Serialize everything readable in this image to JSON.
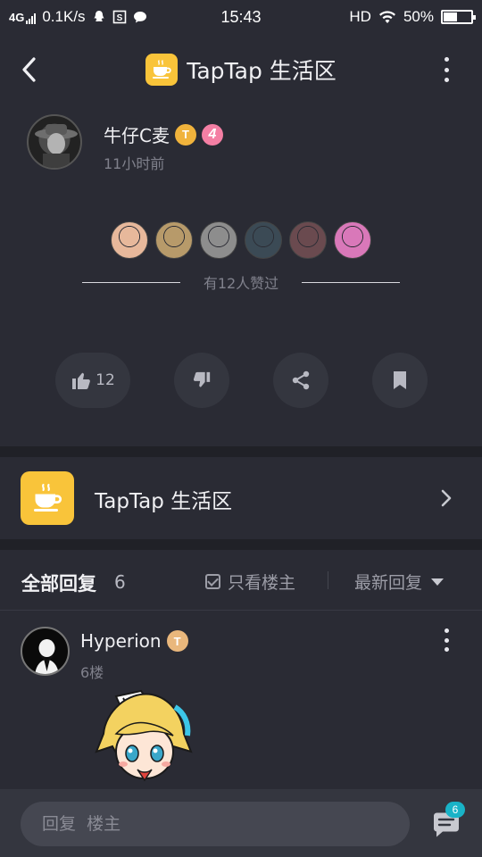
{
  "status_bar": {
    "network": "4G",
    "speed": "0.1K/s",
    "time": "15:43",
    "hd": "HD",
    "battery_percent": "50%",
    "battery_level": 0.5,
    "icons": [
      "qq-icon",
      "s-icon",
      "message-bubble-icon",
      "wifi-icon",
      "battery-icon"
    ]
  },
  "header": {
    "title": "TapTap 生活区",
    "back_icon": "back-arrow-icon",
    "more_icon": "more-vertical-icon"
  },
  "author": {
    "name": "牛仔C麦",
    "badge_t": "T",
    "level": "4",
    "time": "11小时前"
  },
  "likers": {
    "count_text": "有12人赞过",
    "avatar_colors": [
      "#e7b89b",
      "#b79a6a",
      "#8d8d8d",
      "#3b4a55",
      "#6a4a4f",
      "#d978b9"
    ]
  },
  "actions": {
    "like_count": "12",
    "icons": [
      "thumbs-up-icon",
      "thumbs-down-icon",
      "share-icon",
      "bookmark-icon"
    ]
  },
  "group": {
    "name": "TapTap 生活区",
    "icon": "coffee-cup-icon"
  },
  "replies": {
    "title": "全部回复",
    "count": "6",
    "only_op": "只看楼主",
    "sort": "最新回复"
  },
  "reply": {
    "name": "Hyperion",
    "badge_t": "T",
    "floor": "6楼"
  },
  "bottom": {
    "placeholder": "回复  楼主",
    "comment_count": "6"
  },
  "colors": {
    "background": "#2a2b34",
    "accent_yellow": "#f9c43a",
    "badge_teal": "#19b3c7",
    "level_pink": "#f47fa4"
  }
}
